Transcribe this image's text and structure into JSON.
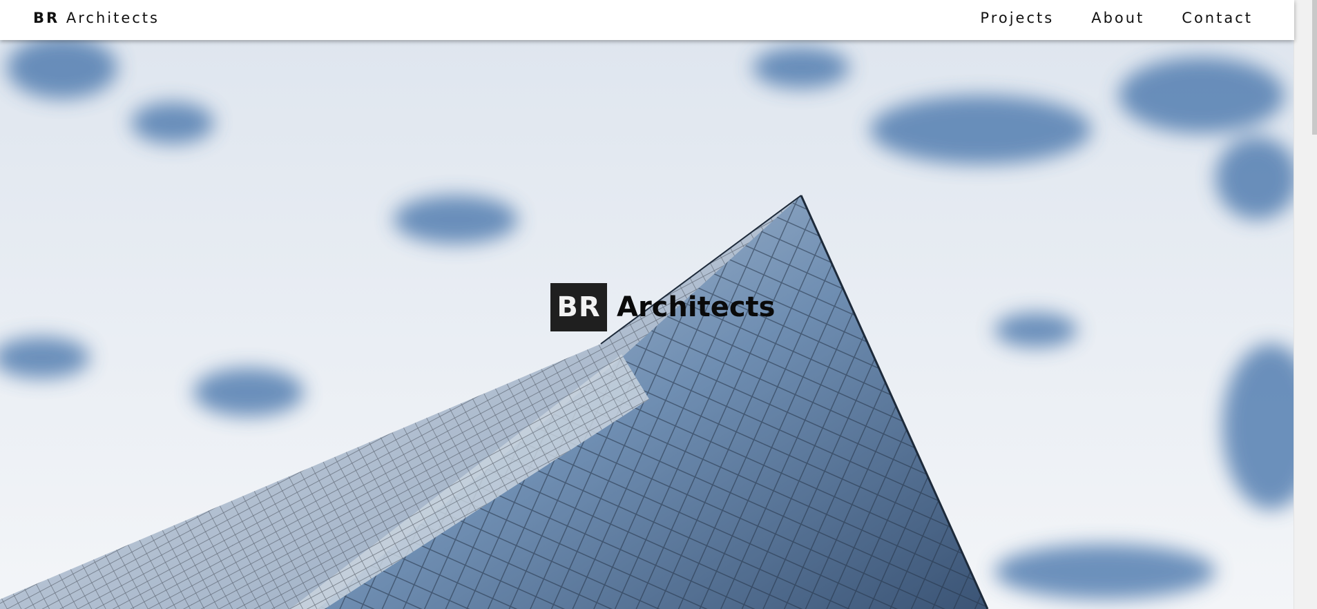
{
  "header": {
    "brand_bold": "BR",
    "brand_rest": "Architects",
    "nav": [
      "Projects",
      "About",
      "Contact"
    ]
  },
  "hero": {
    "logo_box": "BR",
    "logo_text": "Architects",
    "image_alt": "glass-skyscraper-against-cloudy-sky"
  },
  "colors": {
    "header_bg": "#ffffff",
    "text": "#111111",
    "logo_box_bg": "#1f1f1f",
    "sky_blue": "#3f6fa8",
    "glass": "#6f8eb2"
  }
}
